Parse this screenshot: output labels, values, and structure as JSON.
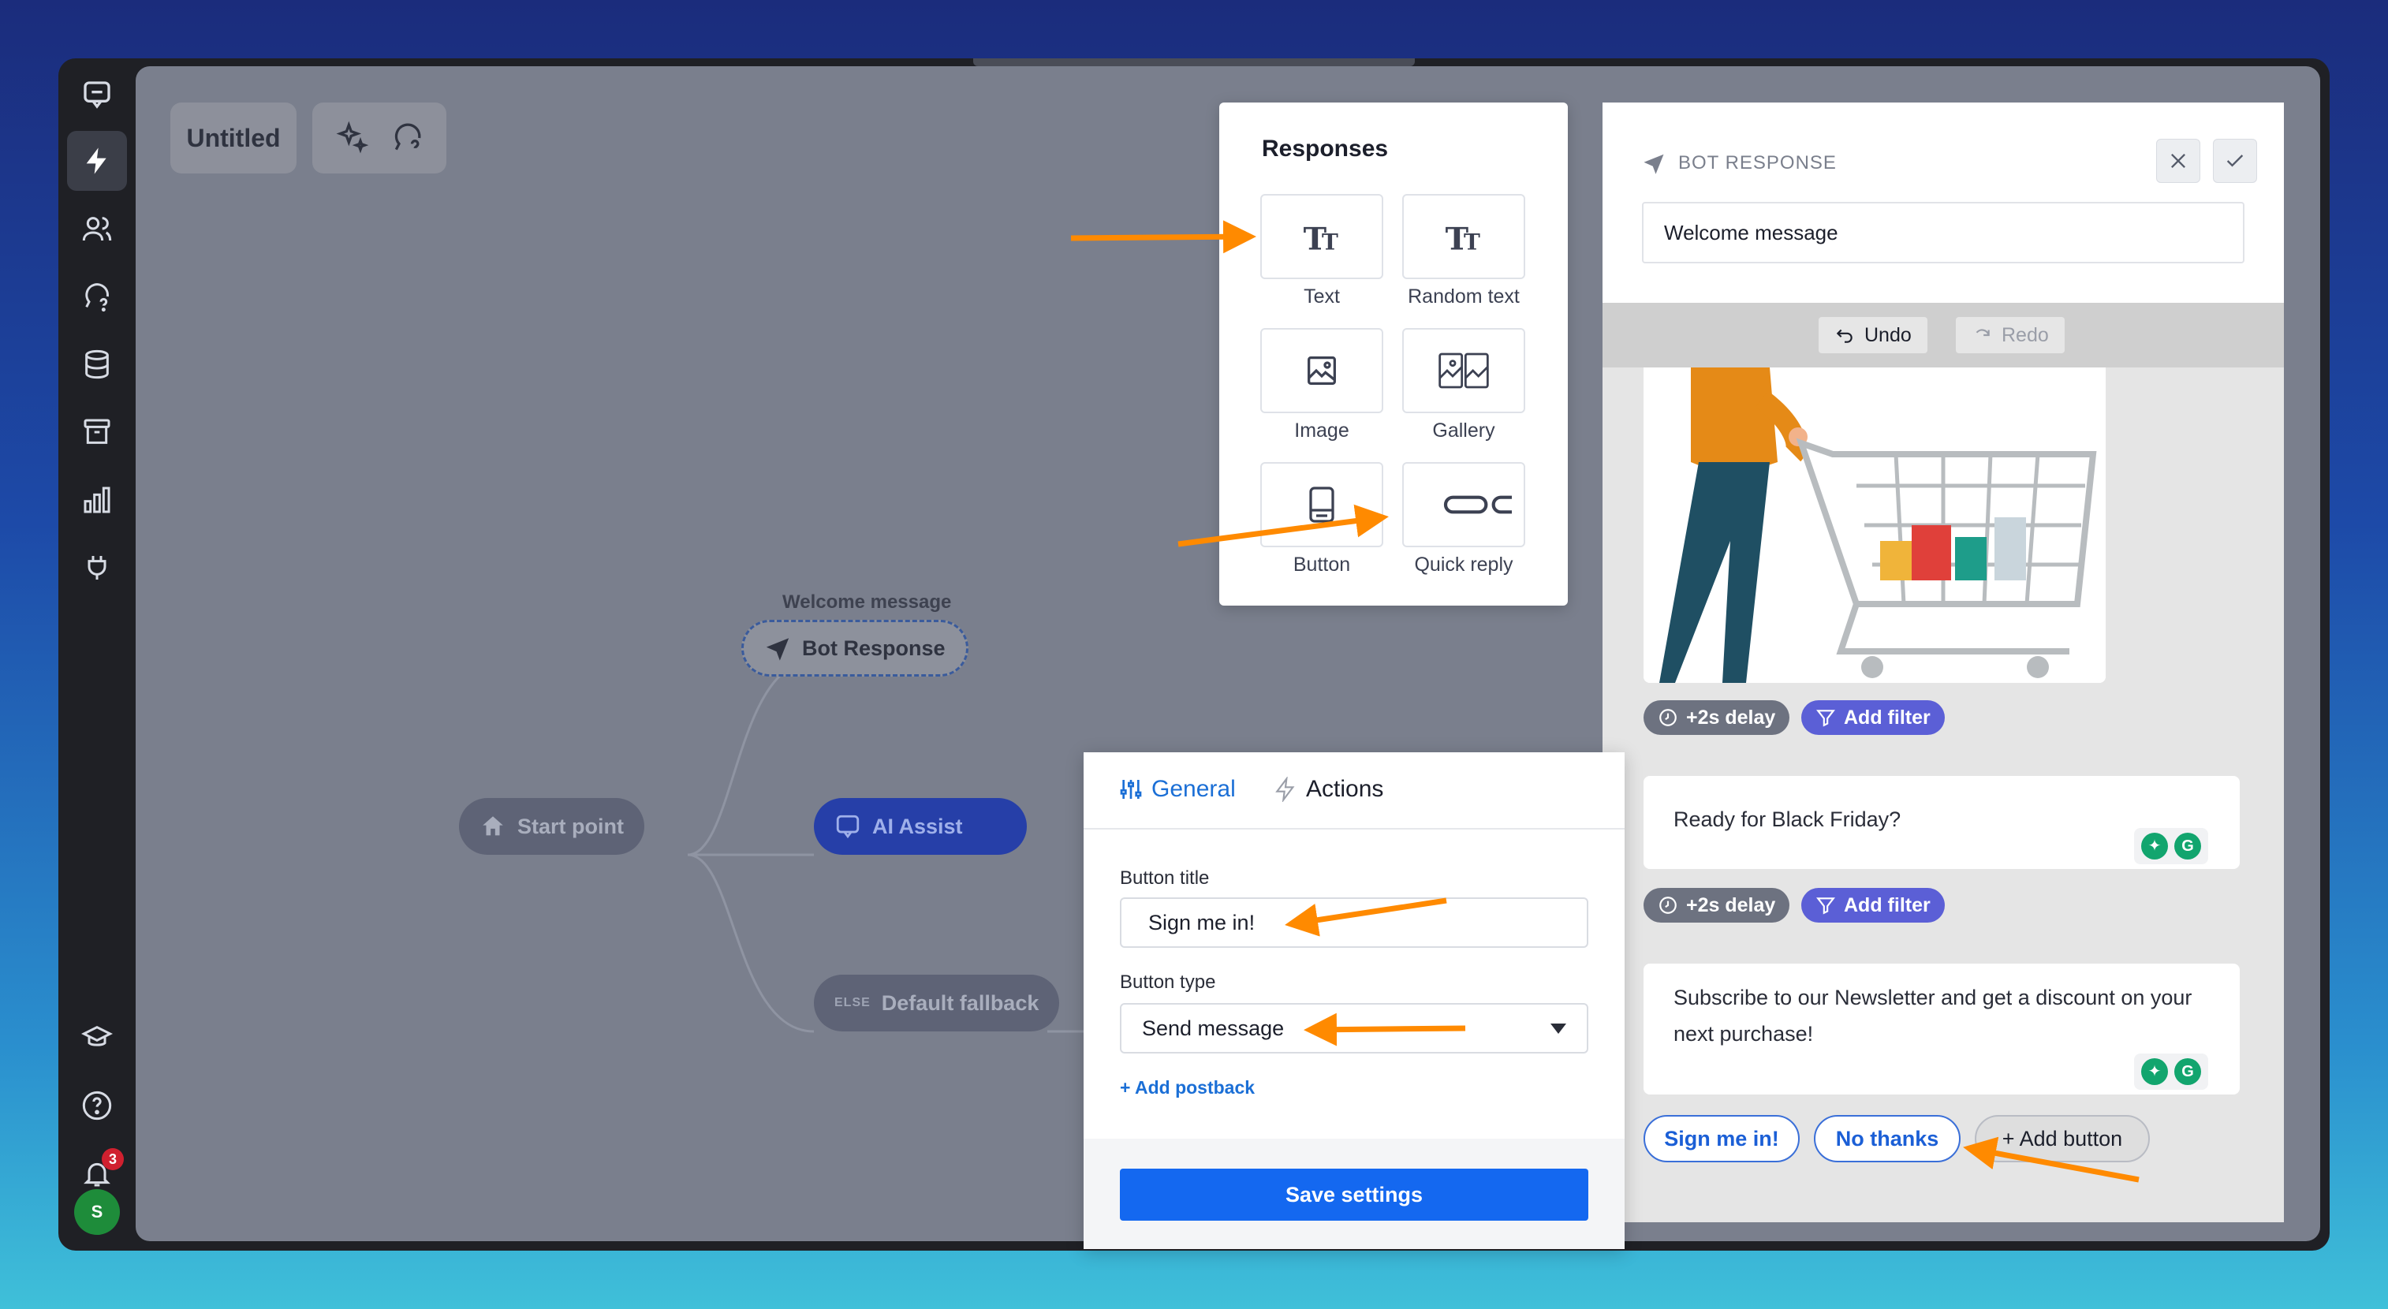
{
  "canvas": {
    "flow_title": "Untitled",
    "nodes": {
      "welcome_label": "Welcome message",
      "bot_response": "Bot Response",
      "start_point": "Start point",
      "ai_assist": "AI Assist",
      "else_tag": "ELSE",
      "default_fallback": "Default fallback"
    }
  },
  "sidebar": {
    "notification_count": "3",
    "avatar_initial": "S"
  },
  "responses": {
    "title": "Responses",
    "items": [
      {
        "label": "Text",
        "icon": "text-icon"
      },
      {
        "label": "Random text",
        "icon": "random-text-icon"
      },
      {
        "label": "Image",
        "icon": "image-icon"
      },
      {
        "label": "Gallery",
        "icon": "gallery-icon"
      },
      {
        "label": "Button",
        "icon": "button-icon"
      },
      {
        "label": "Quick reply",
        "icon": "quick-reply-icon"
      }
    ]
  },
  "bot_panel": {
    "title": "BOT RESPONSE",
    "name_value": "Welcome message",
    "undo_label": "Undo",
    "redo_label": "Redo",
    "delay_label": "+2s delay",
    "filter_label": "Add filter",
    "message_1": "Ready for Black Friday?",
    "message_2": "Subscribe to our Newsletter and get a discount on your next purchase!",
    "quick_buttons": [
      "Sign me in!",
      "No thanks"
    ],
    "add_button_label": "+ Add button"
  },
  "settings": {
    "tab_general": "General",
    "tab_actions": "Actions",
    "button_title_label": "Button title",
    "button_title_value": "Sign me in!",
    "button_type_label": "Button type",
    "button_type_value": "Send message",
    "add_postback": "+ Add postback",
    "save_label": "Save settings"
  },
  "colors": {
    "accent_blue": "#1468f0",
    "filter_purple": "#5b5fd6",
    "annotation_orange": "#ff8a00"
  }
}
